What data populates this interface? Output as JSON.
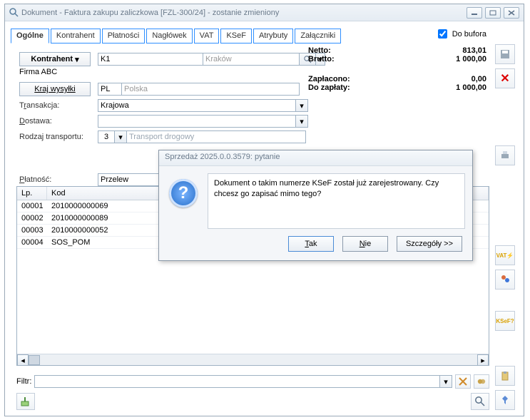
{
  "title": "Dokument - Faktura zakupu zaliczkowa [FZL-300/24]  - zostanie zmieniony",
  "doBuforaLabel": "Do bufora",
  "doBuforaChecked": true,
  "tabs": [
    "Ogólne",
    "Kontrahent",
    "Płatności",
    "Nagłówek",
    "VAT",
    "KSeF",
    "Atrybuty",
    "Załączniki"
  ],
  "activeTab": 0,
  "kontrahent": {
    "buttonLabel": "Kontrahent",
    "code": "K1",
    "city": "Kraków",
    "name": "Firma ABC"
  },
  "krajWysylki": {
    "buttonLabel": "Kraj wysyłki",
    "code": "PL",
    "name": "Polska"
  },
  "transakcja": {
    "label_pre": "T",
    "label_u": "r",
    "label_post": "ansakcja:",
    "value": "Krajowa"
  },
  "dostawa": {
    "label_pre": "",
    "label_u": "D",
    "label_post": "ostawa:",
    "value": ""
  },
  "rodzajTransportu": {
    "label_pre": "Rodza",
    "label_u": "j",
    "label_post": " transportu:",
    "value": "3",
    "placeholder": "Transport drogowy"
  },
  "platnosc": {
    "label_pre": "",
    "label_u": "P",
    "label_post": "łatność:",
    "value": "Przelew"
  },
  "totals": {
    "netto_k": "Netto:",
    "netto_v": "813,01",
    "brutto_k": "Brutto:",
    "brutto_v": "1 000,00",
    "zapl_k": "Zapłacono:",
    "zapl_v": "0,00",
    "do_k": "Do zapłaty:",
    "do_v": "1 000,00"
  },
  "grid": {
    "columns": {
      "lp": "Lp.",
      "kod": "Kod"
    },
    "widths": {
      "lp": 42,
      "kod": 140
    },
    "rows": [
      {
        "lp": "00001",
        "kod": "2010000000069"
      },
      {
        "lp": "00002",
        "kod": "2010000000089"
      },
      {
        "lp": "00003",
        "kod": "2010000000052"
      },
      {
        "lp": "00004",
        "kod": "SOS_POM"
      }
    ]
  },
  "filterLabel": "Filtr:",
  "modal": {
    "title": "Sprzedaż 2025.0.0.3579: pytanie",
    "message": "Dokument o takim numerze KSeF został już zarejestrowany. Czy chcesz go zapisać mimo tego?",
    "btnYes": {
      "pre": "",
      "u": "T",
      "post": "ak"
    },
    "btnNo": {
      "pre": "",
      "u": "N",
      "post": "ie"
    },
    "btnDetails": "Szczegóły >>"
  }
}
